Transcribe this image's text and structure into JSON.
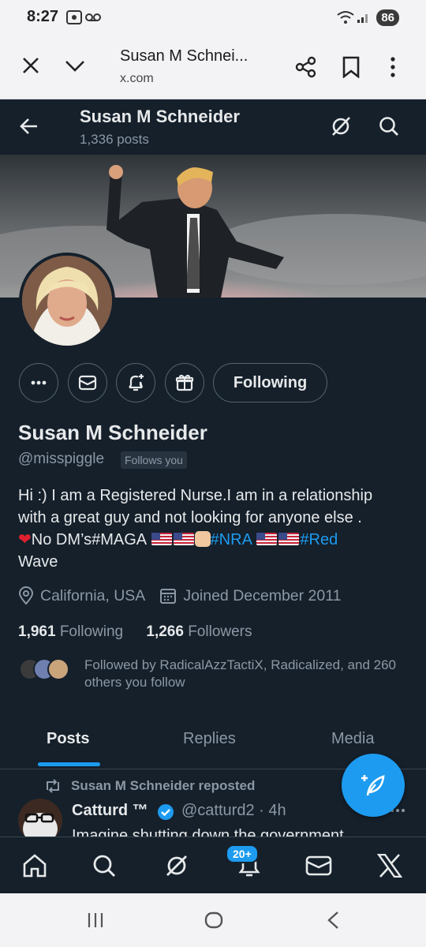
{
  "status_bar": {
    "time": "8:27",
    "battery": "86"
  },
  "browser": {
    "title": "Susan M Schnei...",
    "url": "x.com"
  },
  "header": {
    "name": "Susan M Schneider",
    "post_count": "1,336 posts"
  },
  "profile": {
    "following_button": "Following",
    "name": "Susan M Schneider",
    "handle": "@misspiggle",
    "follows_you": "Follows you",
    "bio_line1": "Hi :) I am a Registered Nurse.I am in a relationship",
    "bio_line2": "with a great guy and not looking for anyone else .",
    "bio_nodms": "No DM’s#MAGA",
    "bio_tag_nra": "#NRA",
    "bio_tag_red": "#Red",
    "bio_line4": "Wave",
    "location": "California, USA",
    "joined": "Joined December 2011",
    "following_count": "1,961",
    "following_label": "Following",
    "followers_count": "1,266",
    "followers_label": "Followers",
    "followed_by": "Followed by RadicalAzzTactiX, Radicalized, and 260 others you follow"
  },
  "tabs": {
    "posts": "Posts",
    "replies": "Replies",
    "media": "Media"
  },
  "tweet": {
    "repost_label": "Susan M Schneider reposted",
    "author": "Catturd ™",
    "handle_time": "@catturd2 · 4h",
    "text": "Imagine shutting down the government"
  },
  "bottom_nav": {
    "notification_badge": "20+"
  },
  "colors": {
    "background": "#15202b",
    "accent": "#1d9bf0",
    "muted": "#8b98a5"
  }
}
